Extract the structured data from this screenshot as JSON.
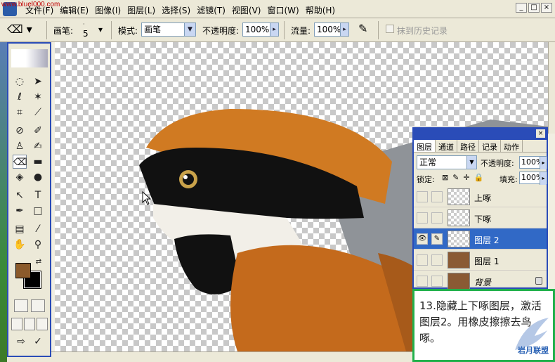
{
  "watermark": "www.bluel000.com",
  "menu": [
    "文件(F)",
    "编辑(E)",
    "图像(I)",
    "图层(L)",
    "选择(S)",
    "滤镜(T)",
    "视图(V)",
    "窗口(W)",
    "帮助(H)"
  ],
  "window_buttons": [
    "_",
    "□",
    "×"
  ],
  "options": {
    "brush_label": "画笔:",
    "brush_size": "5",
    "mode_label": "模式:",
    "mode_value": "画笔",
    "opacity_label": "不透明度:",
    "opacity_value": "100%",
    "flow_label": "流量:",
    "flow_value": "100%",
    "erase_history_label": "抹到历史记录"
  },
  "layers_panel": {
    "tabs": [
      "图层",
      "通道",
      "路径",
      "记录",
      "动作"
    ],
    "blend_mode": "正常",
    "opacity_label": "不透明度:",
    "opacity_value": "100%",
    "lock_label": "锁定:",
    "fill_label": "填充:",
    "fill_value": "100%",
    "layers": [
      {
        "name": "上啄",
        "visible": false,
        "selected": false
      },
      {
        "name": "下啄",
        "visible": false,
        "selected": false
      },
      {
        "name": "图层 2",
        "visible": true,
        "selected": true
      },
      {
        "name": "图层 1",
        "visible": false,
        "selected": false
      },
      {
        "name": "背景",
        "visible": false,
        "selected": false
      }
    ]
  },
  "caption": {
    "text": "13.隐藏上下啄图层，激活图层2。用橡皮擦擦去鸟啄。",
    "badge": "岩月联盟"
  },
  "colors": {
    "foreground": "#8b5a2b",
    "background": "#000000",
    "selection": "#3169c6",
    "caption_border": "#22b14c"
  }
}
